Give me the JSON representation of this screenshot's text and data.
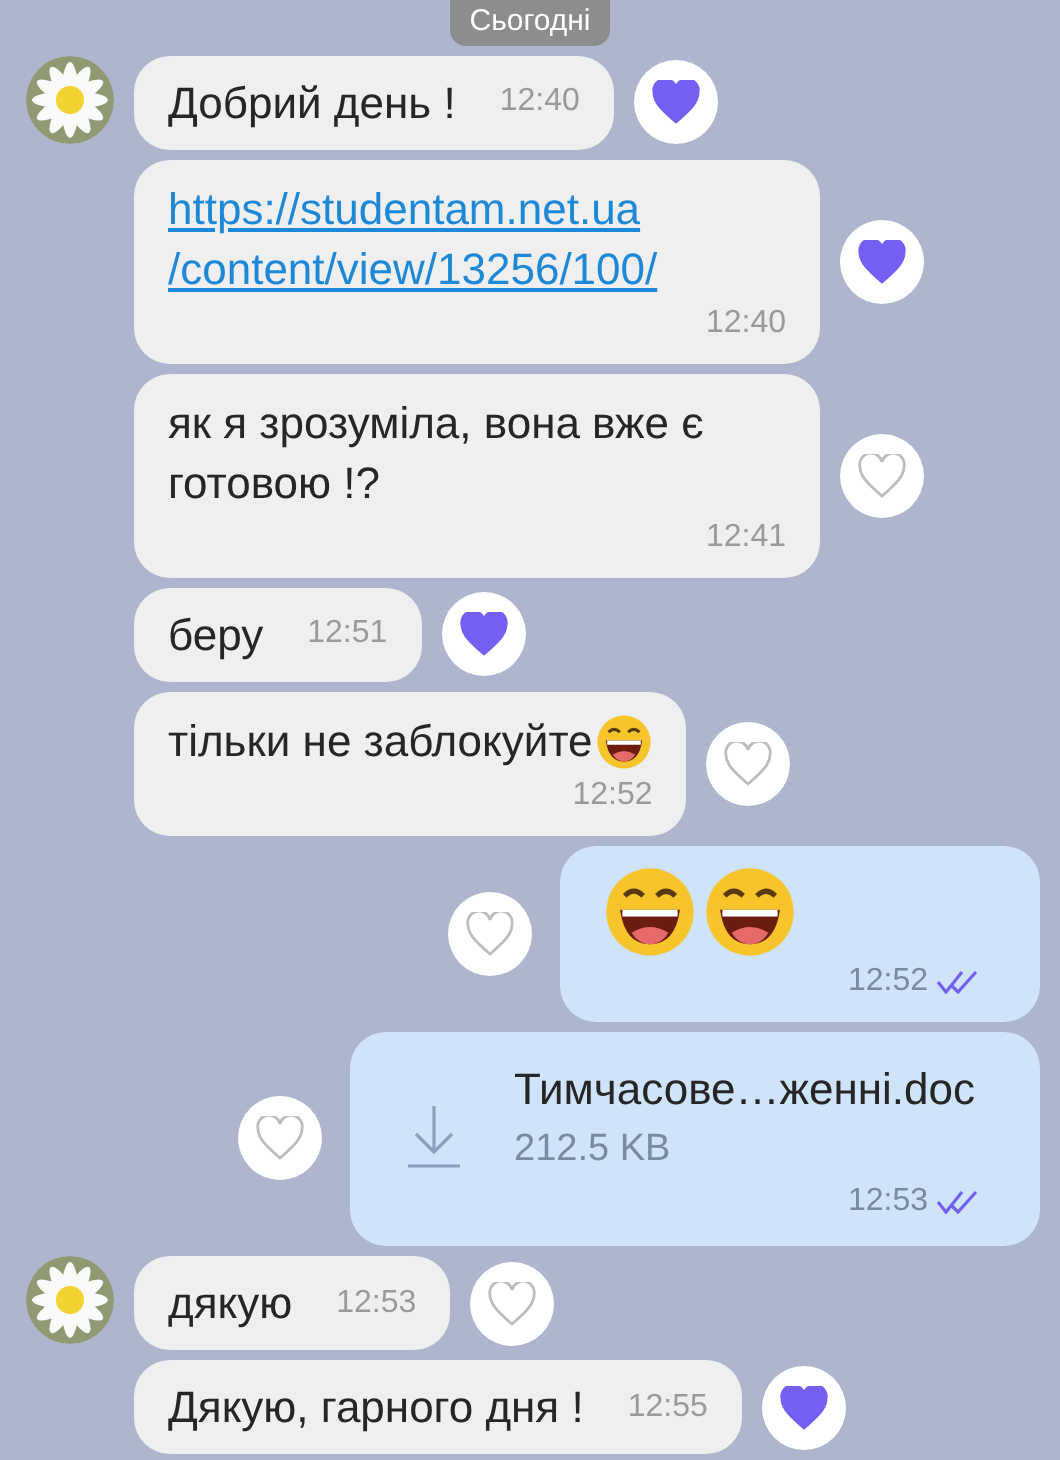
{
  "date_badge": "Сьогодні",
  "messages": [
    {
      "kind": "short",
      "outgoing": false,
      "avatar": true,
      "text": "Добрий день !",
      "time": "12:40",
      "liked": true
    },
    {
      "kind": "link",
      "outgoing": false,
      "avatar": false,
      "text": "https://studentam.net.ua\n/content/view/13256/100/",
      "time": "12:40",
      "liked": true
    },
    {
      "kind": "text",
      "outgoing": false,
      "avatar": false,
      "text": "як я зрозуміла, вона вже є готовою !?",
      "time": "12:41",
      "liked": false
    },
    {
      "kind": "short",
      "outgoing": false,
      "avatar": false,
      "text": "беру",
      "time": "12:51",
      "liked": true
    },
    {
      "kind": "text_emoji",
      "outgoing": false,
      "avatar": false,
      "text": "тільки не заблокуйте",
      "time": "12:52",
      "liked": false
    },
    {
      "kind": "emoji",
      "outgoing": true,
      "time": "12:52",
      "liked": false,
      "read": true
    },
    {
      "kind": "file",
      "outgoing": true,
      "name": "Тимчасове…женні.doc",
      "size": "212.5 KB",
      "time": "12:53",
      "liked": false,
      "read": true
    },
    {
      "kind": "short",
      "outgoing": false,
      "avatar": true,
      "text": "дякую",
      "time": "12:53",
      "liked": false
    },
    {
      "kind": "short",
      "outgoing": false,
      "avatar": false,
      "text": "Дякую, гарного дня !",
      "time": "12:55",
      "liked": true
    }
  ]
}
